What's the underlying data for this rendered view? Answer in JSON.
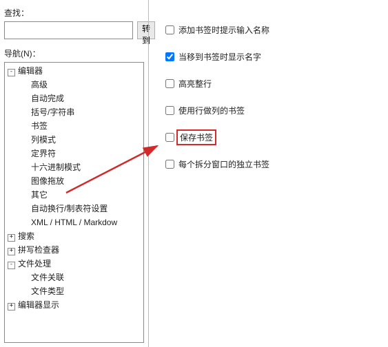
{
  "left": {
    "find_label": "查找：",
    "go_button": "转到",
    "nav_label": "导航(N)：",
    "tree": {
      "root": [
        {
          "label": "编辑器",
          "expanded": true,
          "children": [
            {
              "label": "高级"
            },
            {
              "label": "自动完成"
            },
            {
              "label": "括号/字符串"
            },
            {
              "label": "书签"
            },
            {
              "label": "列模式"
            },
            {
              "label": "定界符"
            },
            {
              "label": "十六进制模式"
            },
            {
              "label": "图像拖放"
            },
            {
              "label": "其它"
            },
            {
              "label": "自动换行/制表符设置"
            },
            {
              "label": "XML / HTML / Markdow"
            }
          ]
        },
        {
          "label": "搜索",
          "expanded": false,
          "hasChildren": true
        },
        {
          "label": "拼写检查器",
          "expanded": false,
          "hasChildren": true
        },
        {
          "label": "文件处理",
          "expanded": true,
          "children": [
            {
              "label": "文件关联"
            },
            {
              "label": "文件类型"
            }
          ]
        },
        {
          "label": "编辑器显示",
          "expanded": false,
          "hasChildren": true
        }
      ]
    }
  },
  "options": [
    {
      "id": "opt-prompt-name",
      "label": "添加书签时提示输入名称",
      "checked": false
    },
    {
      "id": "opt-show-name",
      "label": "当移到书签时显示名字",
      "checked": true
    },
    {
      "id": "opt-highlight-line",
      "label": "高亮整行",
      "checked": false
    },
    {
      "id": "opt-line-as-col",
      "label": "使用行做列的书签",
      "checked": false
    },
    {
      "id": "opt-save",
      "label": "保存书签",
      "checked": false,
      "highlight": true
    },
    {
      "id": "opt-split",
      "label": "每个拆分窗口的独立书签",
      "checked": false
    }
  ]
}
